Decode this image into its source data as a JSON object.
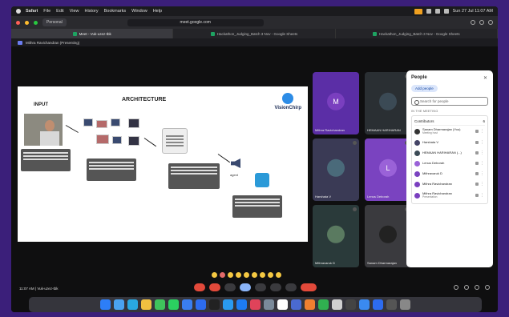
{
  "menubar": {
    "app": "Safari",
    "items": [
      "File",
      "Edit",
      "View",
      "History",
      "Bookmarks",
      "Window",
      "Help"
    ],
    "datetime": "Sun 27 Jul 11:07 AM"
  },
  "toolbar": {
    "profile": "Personal",
    "url": "meet.google.com"
  },
  "tabs": [
    {
      "label": "Meet - Vuk-uzez-tbk",
      "active": true,
      "favicon_color": "#1ea362"
    },
    {
      "label": "Hackathon_Judging_Batch 3 Nov - Google Sheets",
      "active": false,
      "favicon_color": "#1ea362"
    },
    {
      "label": "Hackathon_Judging_Batch 3 Nov - Google Sheets",
      "active": false,
      "favicon_color": "#1ea362"
    }
  ],
  "presenting": "Mithra Ravichandran (Presenting)",
  "slide": {
    "title": "ARCHITECTURE",
    "input_label": "INPUT",
    "logo_text": "VisionChirp",
    "agent_label": "agent"
  },
  "tiles": [
    {
      "name": "Mithra Ravichandran",
      "initial": "M",
      "avatar_color": "#7a3fbf",
      "bg": "#5b2ea6",
      "type": "avatar"
    },
    {
      "name": "HEMAAN HARIHARAN",
      "initial": "",
      "avatar_color": "#3b4a55",
      "bg": "#2a2f33",
      "type": "photo"
    },
    {
      "name": "Harshata V",
      "initial": "",
      "avatar_color": "#4a6a7a",
      "bg": "#3a3a55",
      "type": "photo"
    },
    {
      "name": "Lenus Deborah",
      "initial": "L",
      "avatar_color": "#9a62d8",
      "bg": "#7a43c0",
      "type": "avatar"
    },
    {
      "name": "Mithravaruk D",
      "initial": "",
      "avatar_color": "#5a7a60",
      "bg": "#2a3a3a",
      "type": "photo"
    },
    {
      "name": "Sanam Dharmarajan",
      "initial": "",
      "avatar_color": "#222222",
      "bg": "#3a3a3e",
      "type": "photo"
    }
  ],
  "people": {
    "title": "People",
    "add_label": "Add people",
    "search_placeholder": "Search for people",
    "section": "IN THE MEETING",
    "group_label": "Contributors",
    "group_count": "6",
    "members": [
      {
        "name": "Sanam Dharmarajan (You)",
        "sub": "Meeting host",
        "color": "#333333"
      },
      {
        "name": "Harshata V",
        "sub": "",
        "color": "#444466"
      },
      {
        "name": "HEMAAN HARIHARAN (...)",
        "sub": "",
        "color": "#3b4a55"
      },
      {
        "name": "Lenus Deborah",
        "sub": "",
        "color": "#9a62d8"
      },
      {
        "name": "Mithravaruk D",
        "sub": "",
        "color": "#7a43c0"
      },
      {
        "name": "Mithra Ravichandran",
        "sub": "",
        "color": "#7a3fbf"
      },
      {
        "name": "Mithra Ravichandran",
        "sub": "Presentation",
        "color": "#7a3fbf"
      }
    ]
  },
  "bottom": {
    "clock": "11:07 AM | Vuk-uzez-tbk"
  },
  "dock_colors": [
    "#2d7ef7",
    "#4aa3f0",
    "#29a8e0",
    "#f0c040",
    "#3fc35c",
    "#2bd060",
    "#3a7ef0",
    "#2d6cf0",
    "#222222",
    "#2a9af0",
    "#1d7cf2",
    "#e0435a",
    "#7a8a9a",
    "#ffffff",
    "#4a6ad0",
    "#f08030",
    "#30b050",
    "#d0d0d0",
    "#444444",
    "#3a8af0",
    "#2d6cf0",
    "#555555",
    "#888888"
  ]
}
